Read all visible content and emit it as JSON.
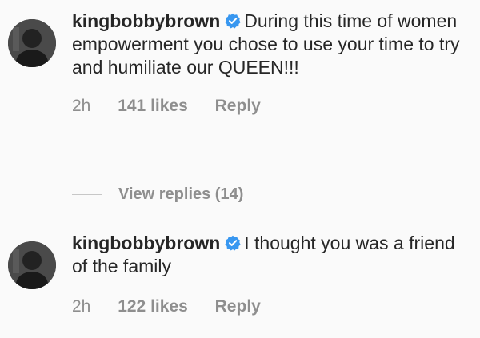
{
  "comments": [
    {
      "username": "kingbobbybrown",
      "verified": true,
      "text": "During this time of women empowerment you chose to use your time to try and humiliate our QUEEN!!!",
      "time": "2h",
      "likes": "141 likes",
      "reply_label": "Reply"
    },
    {
      "username": "kingbobbybrown",
      "verified": true,
      "text": "I thought you was a friend of the family",
      "time": "2h",
      "likes": "122 likes",
      "reply_label": "Reply"
    }
  ],
  "view_replies_label": "View replies (14)",
  "colors": {
    "text": "#262626",
    "muted": "#8e8e8e",
    "verified": "#3897f0",
    "background": "#fafafa"
  },
  "icons": {
    "verified": "verified-badge-icon",
    "avatar": "user-avatar"
  }
}
